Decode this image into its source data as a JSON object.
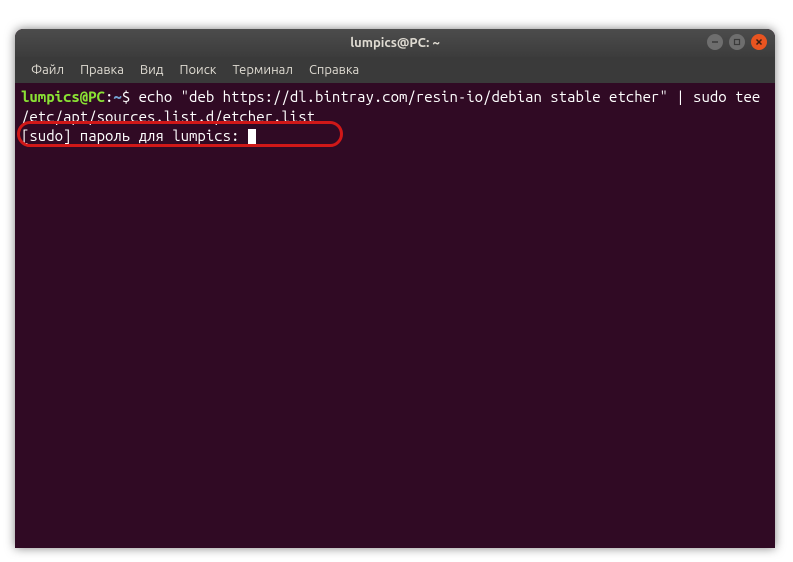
{
  "window": {
    "title": "lumpics@PC: ~"
  },
  "menubar": {
    "file": "Файл",
    "edit": "Правка",
    "view": "Вид",
    "search": "Поиск",
    "terminal": "Терминал",
    "help": "Справка"
  },
  "terminal": {
    "prompt_user": "lumpics@PC",
    "prompt_sep": ":",
    "prompt_path": "~",
    "prompt_dollar": "$",
    "command": "echo \"deb https://dl.bintray.com/resin-io/debian stable etcher\" | sudo tee /etc/apt/sources.list.d/etcher.list",
    "sudo_prompt": "[sudo] пароль для lumpics: "
  },
  "colors": {
    "terminal_bg": "#300a24",
    "titlebar_bg": "#3c3c3c",
    "prompt_green": "#8ae234",
    "prompt_blue": "#729fcf",
    "highlight_red": "#d01818",
    "close_orange": "#e95420"
  }
}
